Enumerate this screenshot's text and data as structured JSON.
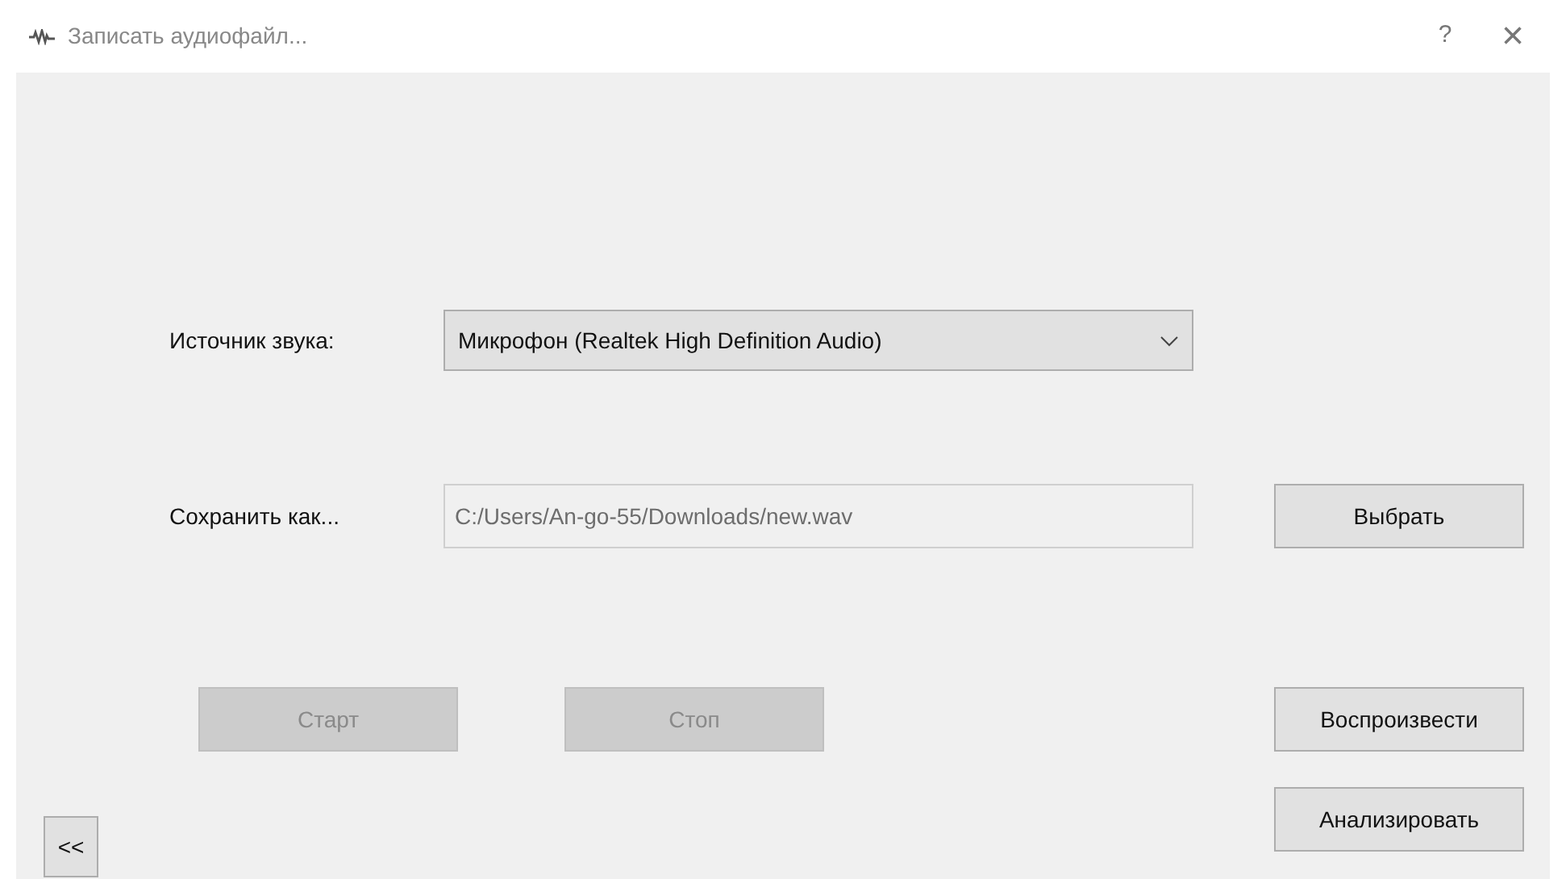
{
  "window": {
    "title": "Записать аудиофайл...",
    "help": "?",
    "close": "×"
  },
  "source": {
    "label": "Источник звука:",
    "value": "Микрофон (Realtek High Definition Audio)"
  },
  "save_as": {
    "label": "Сохранить как...",
    "value": "C:/Users/An-go-55/Downloads/new.wav",
    "disabled": true,
    "button": "Выбрать"
  },
  "buttons": [
    {
      "label": "Старт",
      "disabled": true
    },
    {
      "label": "Стоп",
      "disabled": true
    },
    {
      "label": "Воспроизвести",
      "disabled": false
    },
    {
      "label": "Анализировать",
      "disabled": false
    }
  ],
  "back_button": "<<"
}
